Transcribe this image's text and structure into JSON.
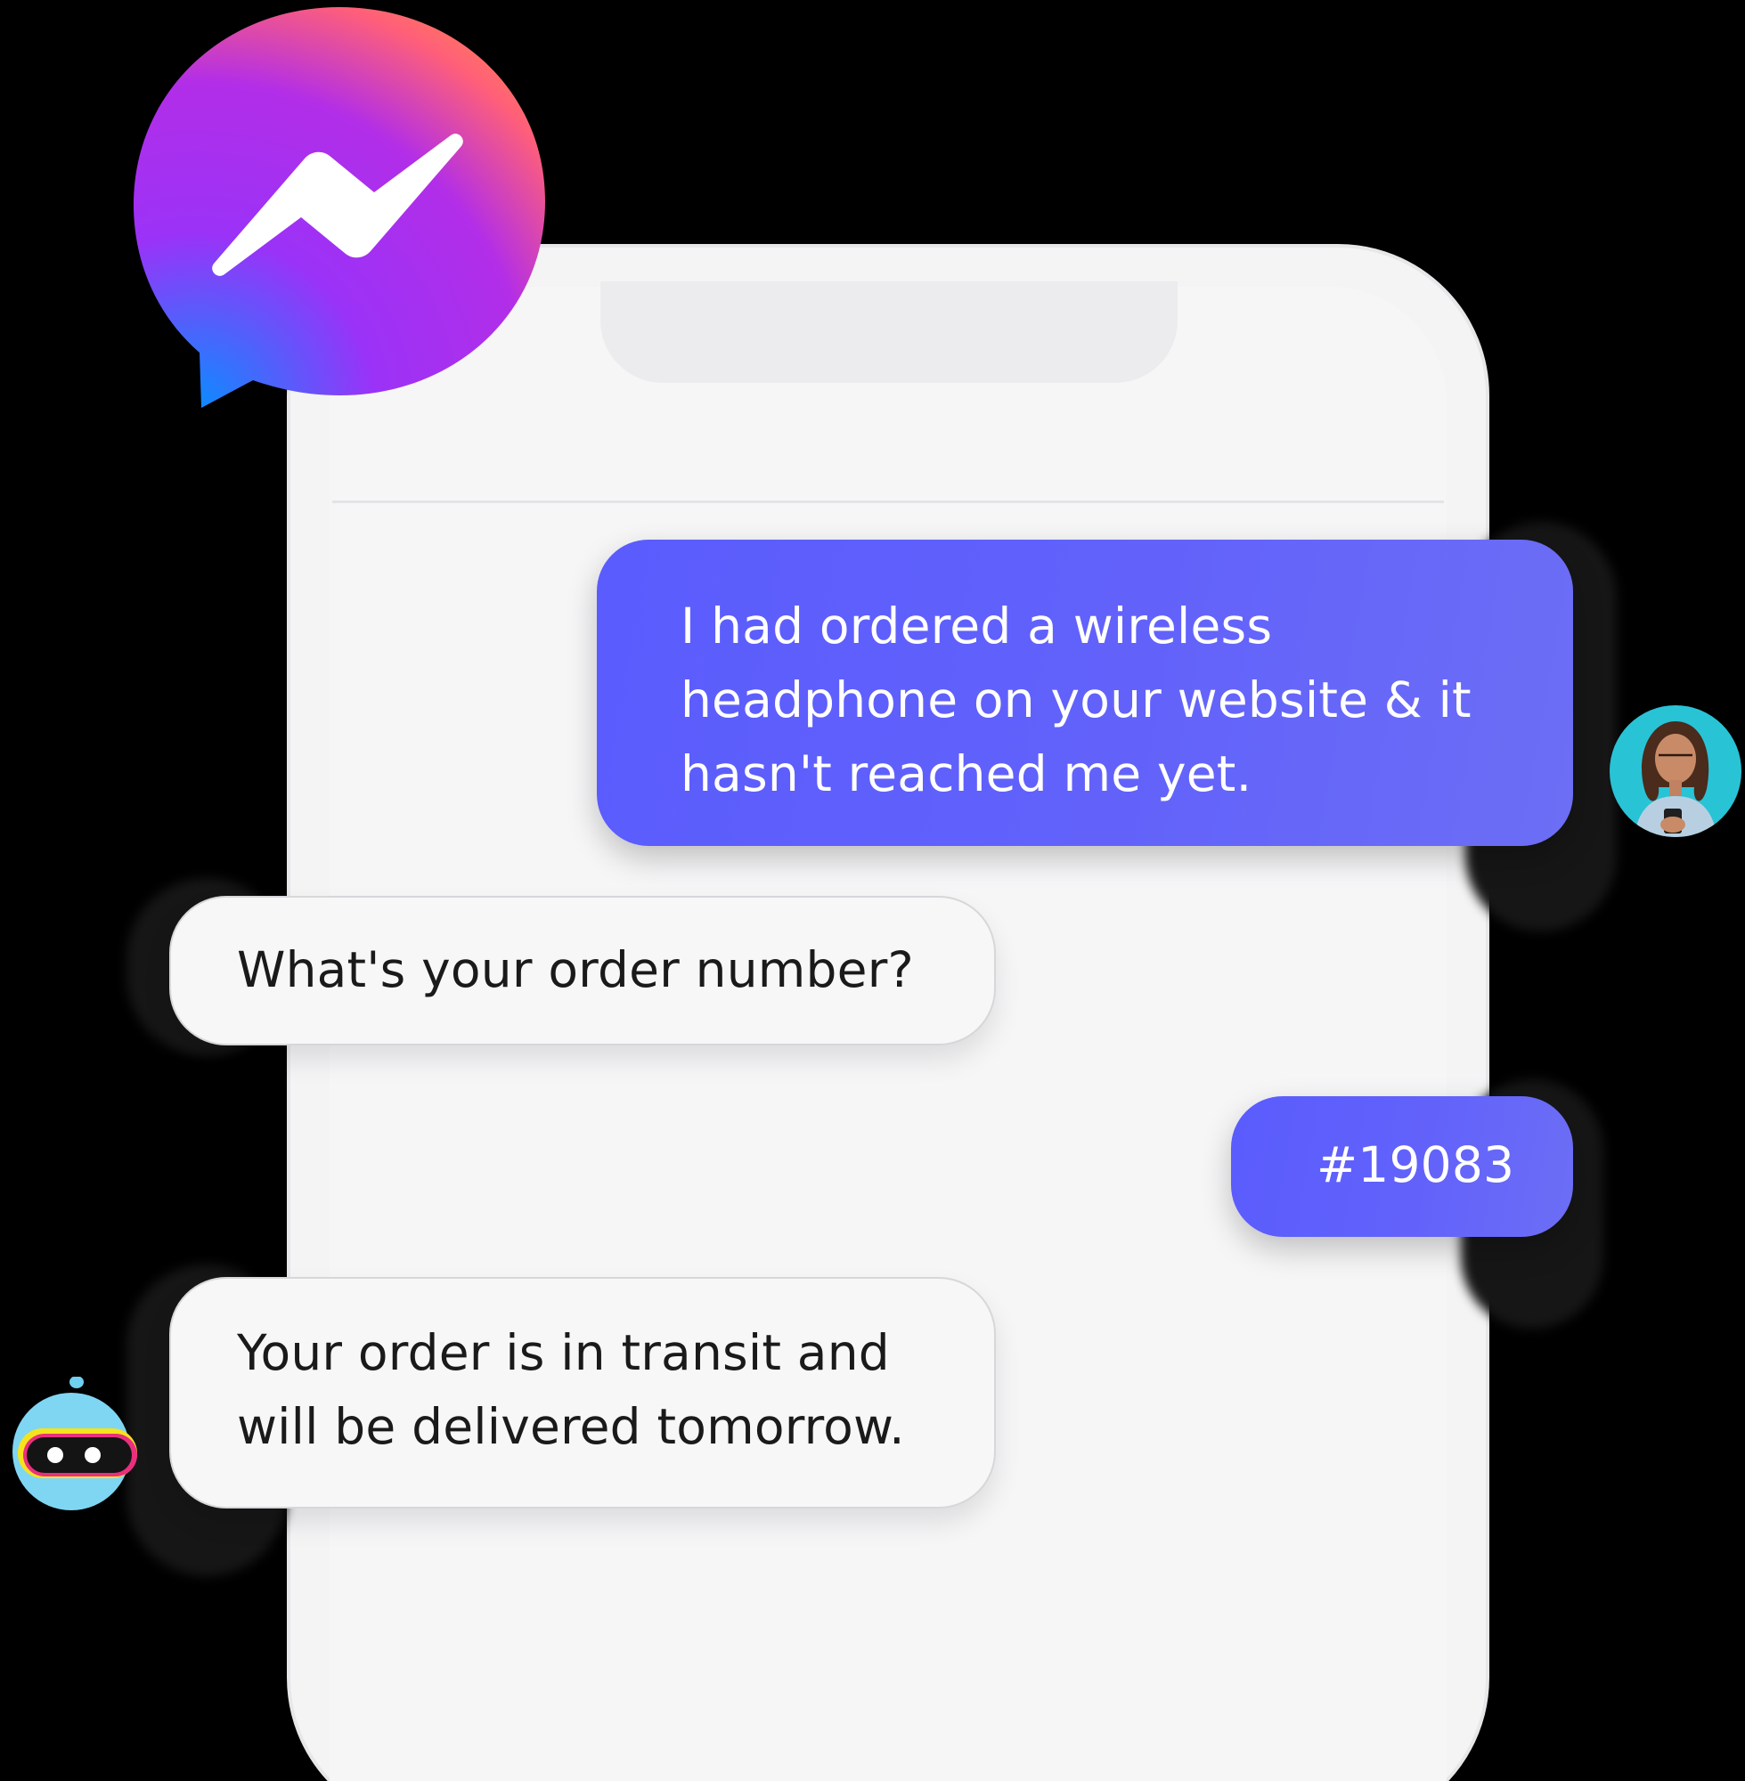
{
  "app": {
    "name": "Messenger"
  },
  "conversation": {
    "messages": [
      {
        "sender": "user",
        "text": "I had ordered a wireless\nheadphone on your website & it\nhasn't reached me yet."
      },
      {
        "sender": "bot",
        "text": "What's your order number?"
      },
      {
        "sender": "user",
        "text": "#19083"
      },
      {
        "sender": "bot",
        "text": "Your order is in transit and\nwill be delivered tomorrow."
      }
    ]
  },
  "colors": {
    "outgoing_bubble": "#5a5cfd",
    "incoming_bubble": "#f7f7f8",
    "phone_body": "#f4f4f5",
    "background": "#000000"
  },
  "icons": {
    "logo": "messenger-logo-icon",
    "user_avatar": "user-avatar",
    "bot_avatar": "bot-avatar"
  }
}
